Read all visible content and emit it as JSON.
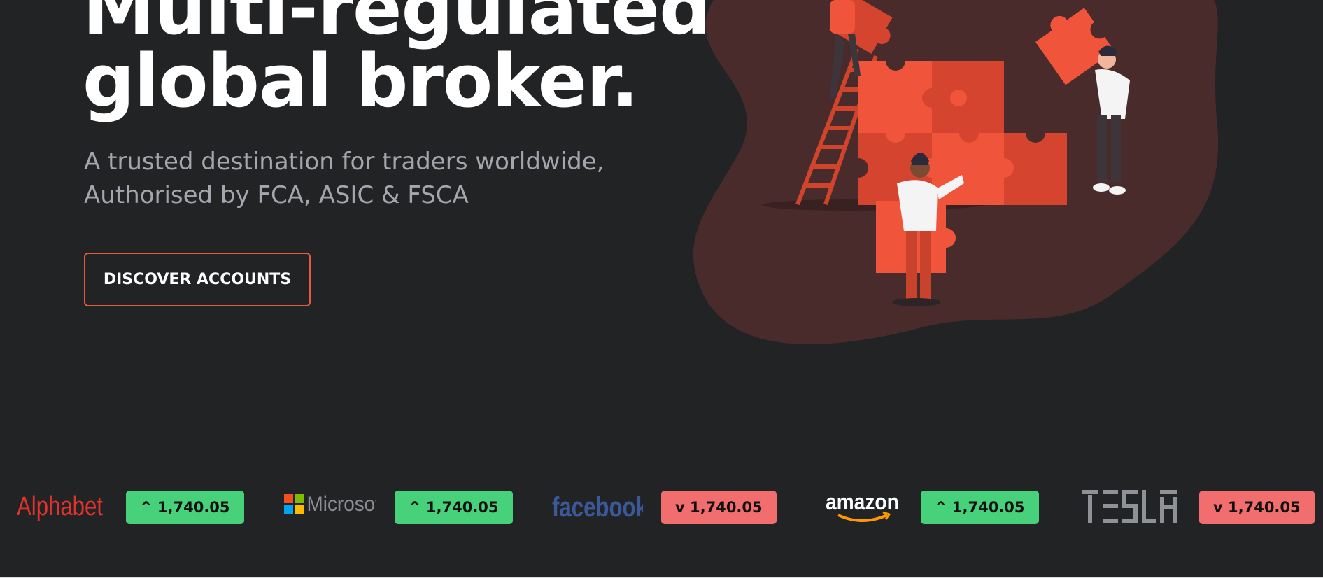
{
  "hero": {
    "title_line1": "Multi-regulated",
    "title_line2": "global broker.",
    "subtitle_line1": "A trusted destination for traders worldwide,",
    "subtitle_line2": "Authorised by FCA, ASIC & FSCA",
    "cta_label": "DISCOVER ACCOUNTS"
  },
  "ticker": [
    {
      "company": "Alphabet",
      "logo_icon": "alphabet-logo",
      "direction": "up",
      "quote": "^ 1,740.05"
    },
    {
      "company": "Microsoft",
      "logo_icon": "microsoft-logo",
      "direction": "up",
      "quote": "^ 1,740.05"
    },
    {
      "company": "facebook",
      "logo_icon": "facebook-logo",
      "direction": "down",
      "quote": "v 1,740.05"
    },
    {
      "company": "amazon",
      "logo_icon": "amazon-logo",
      "direction": "up",
      "quote": "^ 1,740.05"
    },
    {
      "company": "TESLA",
      "logo_icon": "tesla-logo",
      "direction": "down",
      "quote": "v 1,740.05"
    }
  ],
  "colors": {
    "background": "#222325",
    "accent": "#e35a3c",
    "up": "#47d17b",
    "down": "#f26d6d",
    "blob": "#4a2b2b",
    "puzzle": "#f0553c"
  }
}
